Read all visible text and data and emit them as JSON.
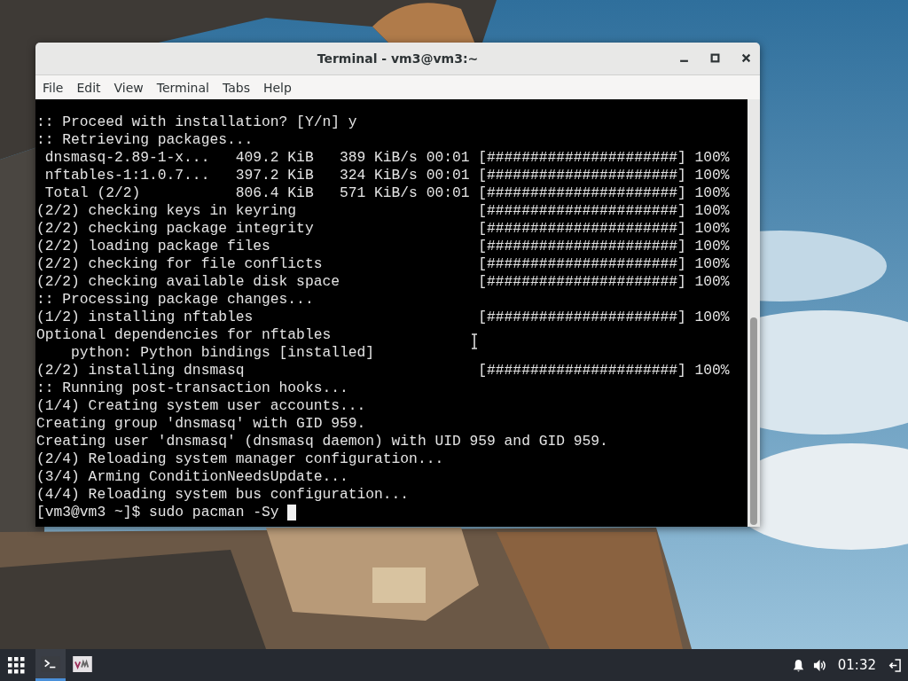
{
  "window": {
    "title": "Terminal - vm3@vm3:~",
    "menu": [
      "File",
      "Edit",
      "View",
      "Terminal",
      "Tabs",
      "Help"
    ]
  },
  "terminal": {
    "lines": [
      ":: Proceed with installation? [Y/n] y",
      ":: Retrieving packages...",
      " dnsmasq-2.89-1-x...   409.2 KiB   389 KiB/s 00:01 [######################] 100%",
      " nftables-1:1.0.7...   397.2 KiB   324 KiB/s 00:01 [######################] 100%",
      " Total (2/2)           806.4 KiB   571 KiB/s 00:01 [######################] 100%",
      "(2/2) checking keys in keyring                     [######################] 100%",
      "(2/2) checking package integrity                   [######################] 100%",
      "(2/2) loading package files                        [######################] 100%",
      "(2/2) checking for file conflicts                  [######################] 100%",
      "(2/2) checking available disk space                [######################] 100%",
      ":: Processing package changes...",
      "(1/2) installing nftables                          [######################] 100%",
      "Optional dependencies for nftables",
      "    python: Python bindings [installed]",
      "(2/2) installing dnsmasq                           [######################] 100%",
      ":: Running post-transaction hooks...",
      "(1/4) Creating system user accounts...",
      "Creating group 'dnsmasq' with GID 959.",
      "Creating user 'dnsmasq' (dnsmasq daemon) with UID 959 and GID 959.",
      "(2/4) Reloading system manager configuration...",
      "(3/4) Arming ConditionNeedsUpdate...",
      "(4/4) Reloading system bus configuration..."
    ],
    "prompt": "[vm3@vm3 ~]$ sudo pacman -Sy ",
    "cursor_visible": true
  },
  "taskbar": {
    "apps": [
      {
        "kind": "terminal",
        "selected": true
      },
      {
        "kind": "vim",
        "selected": false
      }
    ],
    "clock": "01:32"
  }
}
